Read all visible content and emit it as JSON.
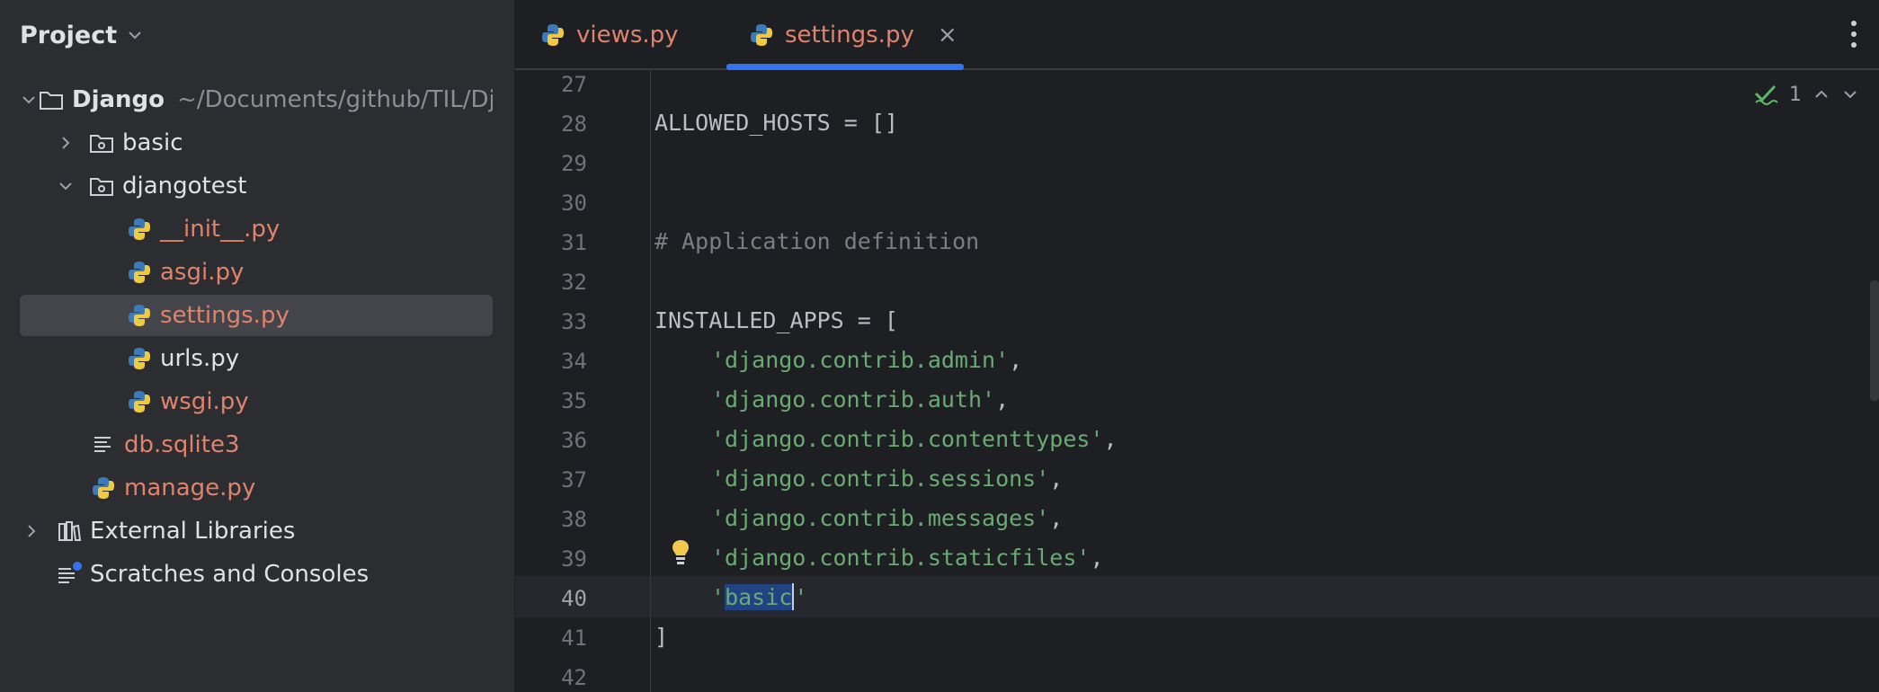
{
  "project_panel": {
    "title": "Project",
    "tree": [
      {
        "label": "Django",
        "path": "~/Documents/github/TIL/Django",
        "icon": "folder-icon",
        "expanded": true,
        "bold": true
      },
      {
        "label": "basic",
        "icon": "module-folder-icon",
        "expanded": false
      },
      {
        "label": "djangotest",
        "icon": "module-folder-icon",
        "expanded": true
      },
      {
        "label": "__init__.py",
        "icon": "python-file-icon"
      },
      {
        "label": "asgi.py",
        "icon": "python-file-icon"
      },
      {
        "label": "settings.py",
        "icon": "python-file-icon",
        "selected": true
      },
      {
        "label": "urls.py",
        "icon": "python-file-icon"
      },
      {
        "label": "wsgi.py",
        "icon": "python-file-icon"
      },
      {
        "label": "db.sqlite3",
        "icon": "text-file-icon"
      },
      {
        "label": "manage.py",
        "icon": "python-file-icon"
      },
      {
        "label": "External Libraries",
        "icon": "library-icon",
        "expanded": false
      },
      {
        "label": "Scratches and Consoles",
        "icon": "scratches-icon"
      }
    ]
  },
  "editor": {
    "tabs": [
      {
        "label": "views.py",
        "active": false
      },
      {
        "label": "settings.py",
        "active": true,
        "close": "×"
      }
    ],
    "inspection_count": "1",
    "line_numbers": [
      "27",
      "28",
      "29",
      "30",
      "31",
      "32",
      "33",
      "34",
      "35",
      "36",
      "37",
      "38",
      "39",
      "40",
      "41",
      "42"
    ],
    "current_line": "40",
    "code": {
      "l28": "ALLOWED_HOSTS = []",
      "l31": "# Application definition",
      "l33": "INSTALLED_APPS = [",
      "l34": "'django.contrib.admin'",
      "l35": "'django.contrib.auth'",
      "l36": "'django.contrib.contenttypes'",
      "l37": "'django.contrib.sessions'",
      "l38": "'django.contrib.messages'",
      "l39": "'django.contrib.staticfiles'",
      "l40_open": "'",
      "l40_selected": "basic",
      "l40_close": "'",
      "l41": "]",
      "comma": ","
    }
  },
  "colors": {
    "accent": "#3574f0",
    "modified_file": "#e0826c",
    "string": "#6aab73",
    "comment": "#7a7e85"
  }
}
